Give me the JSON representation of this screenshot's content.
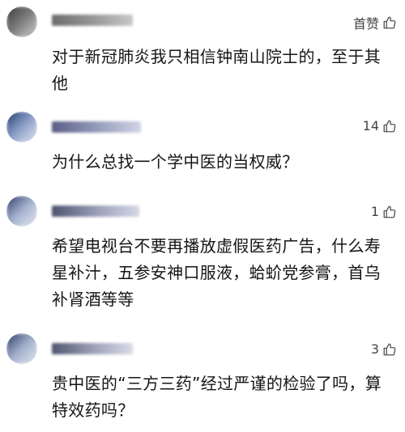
{
  "comments": [
    {
      "like_label": "首赞",
      "text": "对于新冠肺炎我只相信钟南山院士的，至于其他",
      "avatar_colors": [
        "#3d3d3d",
        "#777777",
        "#cfcfcf"
      ],
      "name_colors": [
        "#6d6d6d",
        "#9a9a9a",
        "#c8c8c8"
      ]
    },
    {
      "like_label": "14",
      "text": "为什么总找一个学中医的当权威？",
      "avatar_colors": [
        "#1f3d73",
        "#8fa0c8",
        "#dfe5f2"
      ],
      "name_colors": [
        "#5b5e86",
        "#9aa0bf",
        "#d2d5e6"
      ]
    },
    {
      "like_label": "1",
      "text": "希望电视台不要再播放虚假医药广告，什么寿星补汁，五参安神口服液，蛤蚧党参膏，首乌补肾酒等等",
      "avatar_colors": [
        "#2c3f68",
        "#a7b3cf",
        "#e4e8f1"
      ],
      "name_colors": [
        "#4d5370",
        "#9ea3bb",
        "#d6d8e5"
      ]
    },
    {
      "like_label": "3",
      "text": "贵中医的“三方三药”经过严谨的检验了吗，算特效药吗？",
      "avatar_colors": [
        "#2a3d67",
        "#a4b1cd",
        "#e3e7f0"
      ],
      "name_colors": [
        "#50566f",
        "#a1a6bd",
        "#d8dae6"
      ]
    }
  ]
}
